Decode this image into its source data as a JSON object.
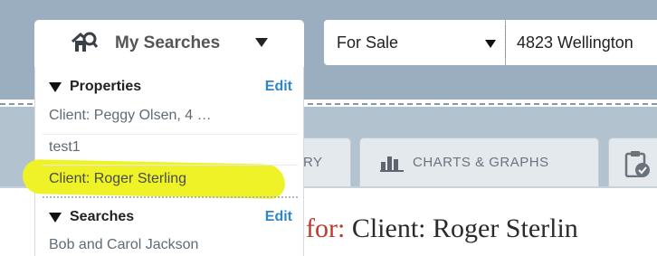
{
  "my_searches": {
    "label": "My Searches",
    "icon": "house-search-icon"
  },
  "status_select": {
    "value": "For Sale"
  },
  "address_input": {
    "value": "4823 Wellington"
  },
  "tabs": [
    {
      "label": "RY",
      "icon": null
    },
    {
      "label": "CHARTS & GRAPHS",
      "icon": "bar-chart-icon"
    },
    {
      "label": "",
      "icon": "clipboard-check-icon"
    }
  ],
  "dropdown": {
    "properties": {
      "title": "Properties",
      "edit_label": "Edit",
      "items": [
        "Client: Peggy Olsen, 4 …",
        "test1",
        "Client: Roger Sterling"
      ],
      "highlighted_index": 2
    },
    "searches": {
      "title": "Searches",
      "edit_label": "Edit",
      "items": [
        "Bob and Carol Jackson"
      ]
    }
  },
  "heading": {
    "prefix": "for:",
    "name": "Client: Roger Sterlin"
  },
  "colors": {
    "edit_link": "#2e86c9",
    "heading_prefix": "#c0392b",
    "highlight": "#eef226",
    "topbar": "#9aaebf"
  }
}
